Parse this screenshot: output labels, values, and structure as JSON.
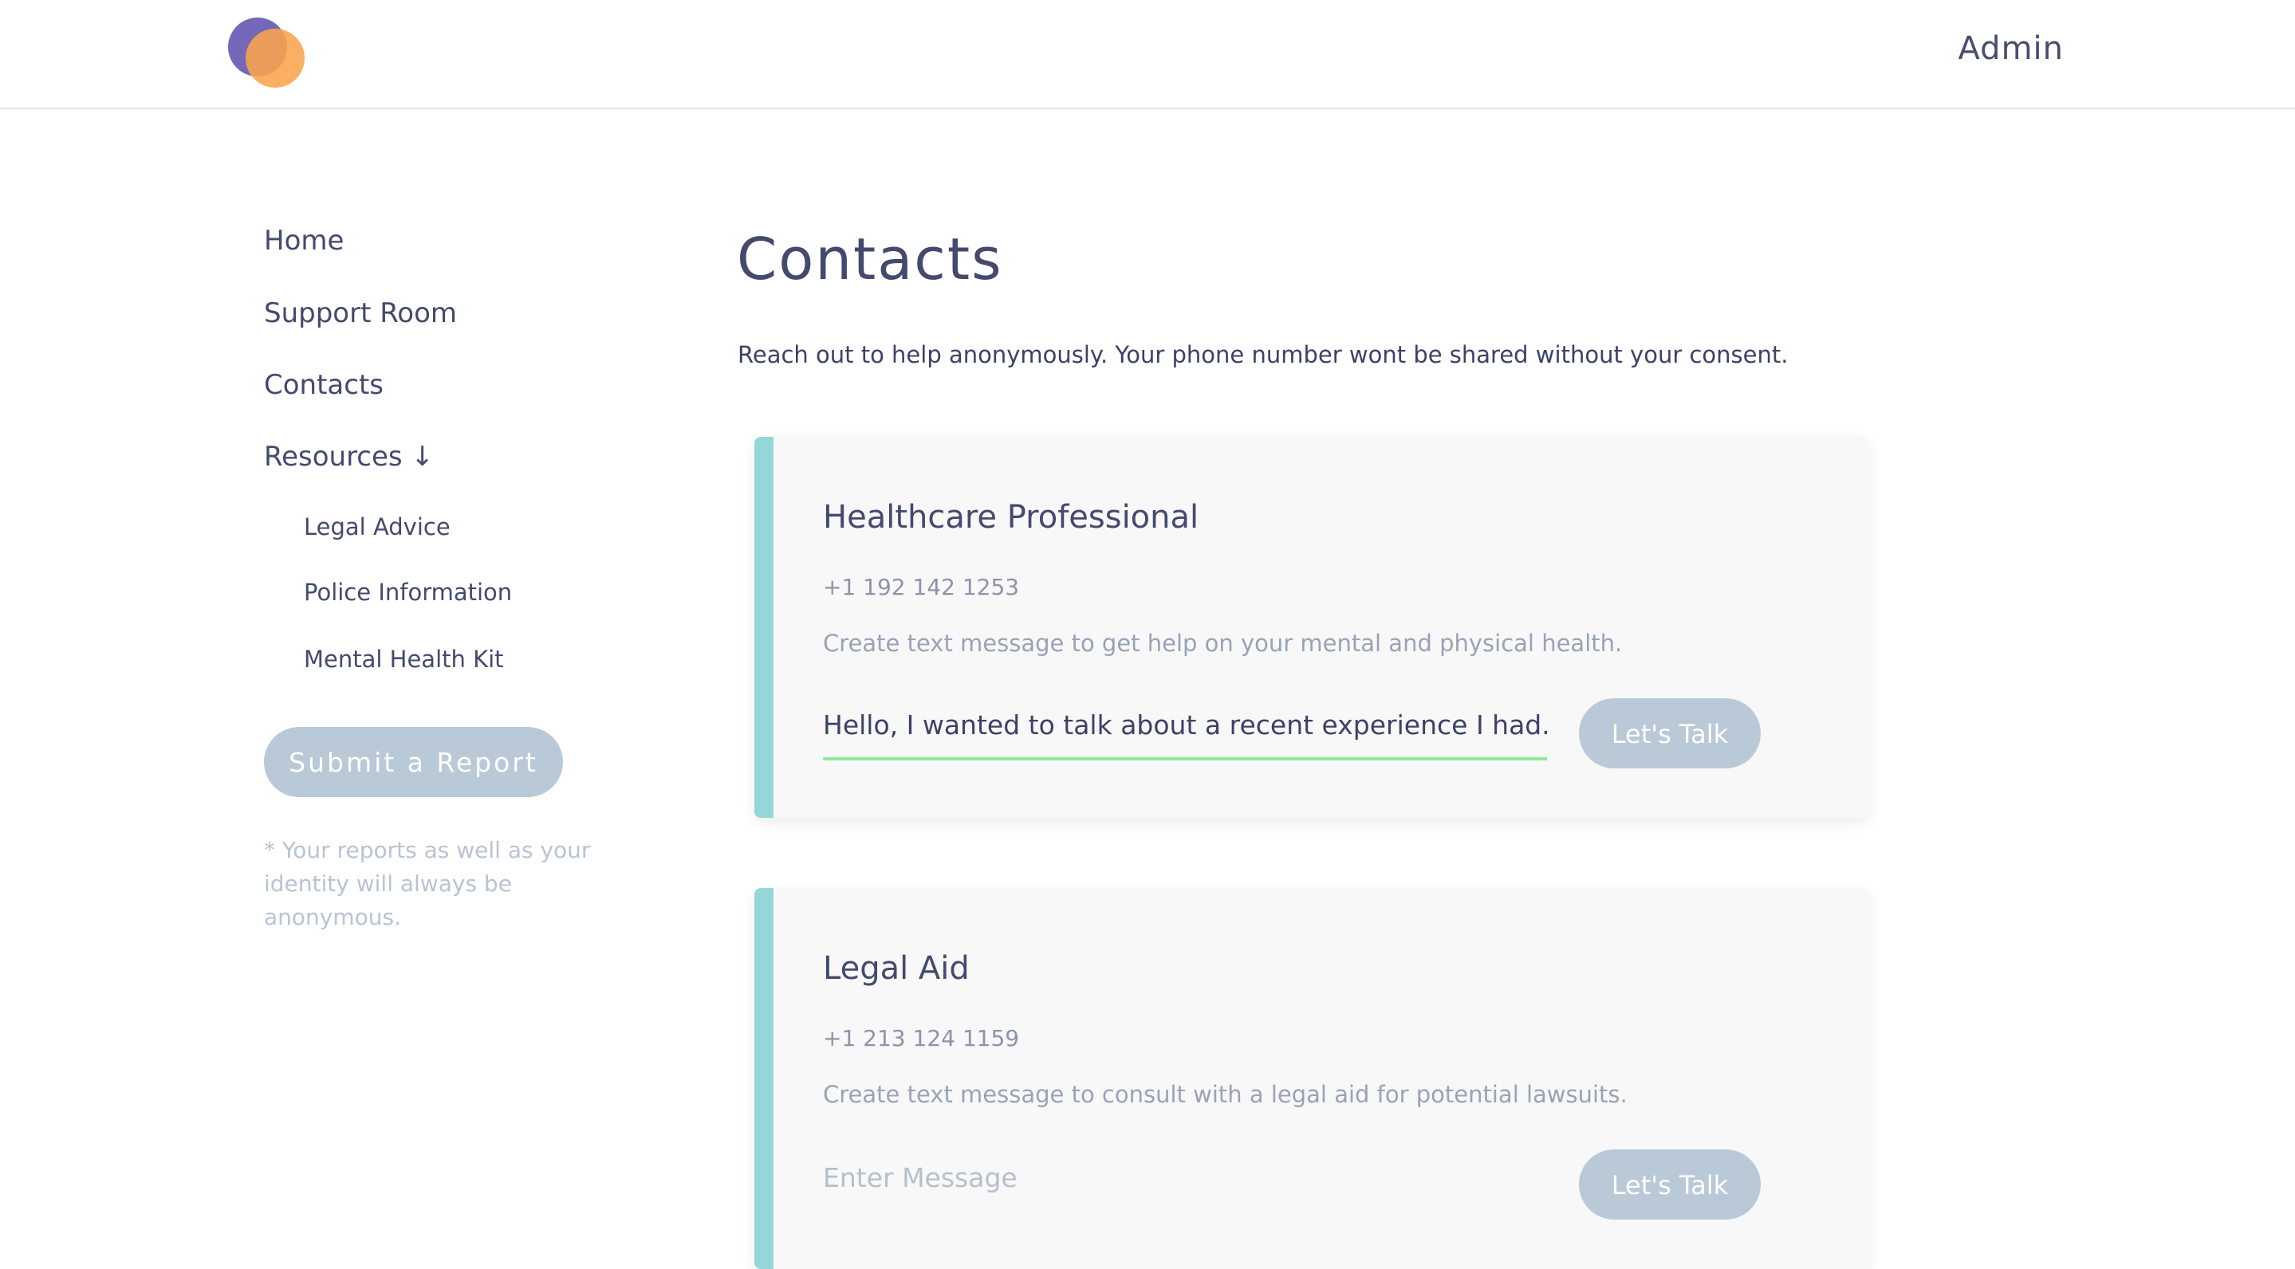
{
  "header": {
    "logo_icon": "overlapping-circles-logo",
    "admin_label": "Admin"
  },
  "sidebar": {
    "items": [
      {
        "label": "Home"
      },
      {
        "label": "Support Room"
      },
      {
        "label": "Contacts"
      },
      {
        "label": "Resources ↓"
      }
    ],
    "sub_items": [
      {
        "label": "Legal Advice"
      },
      {
        "label": "Police Information"
      },
      {
        "label": "Mental Health Kit"
      }
    ],
    "report_button": "Submit a Report",
    "report_note": "* Your reports as well as your identity will always be anonymous."
  },
  "main": {
    "title": "Contacts",
    "intro": "Reach out to help anonymously. Your phone number wont be shared without your consent.",
    "cards": [
      {
        "title": "Healthcare Professional",
        "phone": "+1 192 142 1253",
        "description": "Create text message to get help on your mental and physical health.",
        "message_value": "Hello, I wanted to talk about a recent experience I had.",
        "message_placeholder": "Enter Message",
        "button": "Let's Talk"
      },
      {
        "title": "Legal Aid",
        "phone": "+1 213 124 1159",
        "description": "Create text message to consult with a legal aid for potential lawsuits.",
        "message_value": "",
        "message_placeholder": "Enter Message",
        "button": "Let's Talk"
      }
    ]
  },
  "colors": {
    "accent_bar": "#97d6d8",
    "button": "#b9c9d8",
    "text_dark": "#434a6e",
    "input_focus_underline": "#8eea9c",
    "logo_purple": "#7468b8",
    "logo_orange": "#fba44c"
  }
}
